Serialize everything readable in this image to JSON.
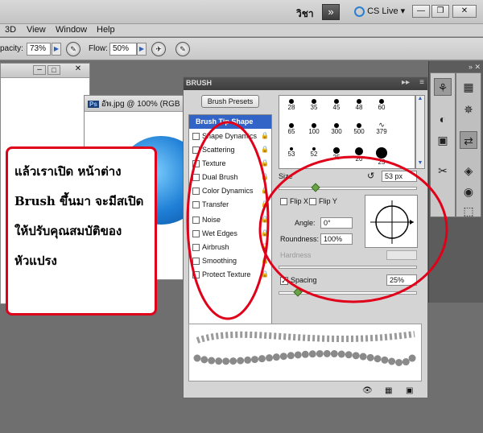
{
  "topbar": {
    "user_label": "วิชา",
    "cs_live": "CS Live",
    "minimize": "—",
    "restore": "❐",
    "close": "✕"
  },
  "menu": {
    "items": [
      "3D",
      "View",
      "Window",
      "Help"
    ]
  },
  "options_bar": {
    "opacity_label": "pacity:",
    "opacity_value": "73%",
    "flow_label": "Flow:",
    "flow_value": "50%"
  },
  "document": {
    "tab_title": "อัพ.jpg @ 100% (RGB",
    "ps_badge": "Ps"
  },
  "brush_panel": {
    "tab_title": "BRUSH",
    "presets_button": "Brush Presets",
    "options": [
      {
        "label": "Brush Tip Shape",
        "checkbox": false,
        "lock": false,
        "selected": true
      },
      {
        "label": "Shape Dynamics",
        "checkbox": true,
        "lock": true,
        "selected": false
      },
      {
        "label": "Scattering",
        "checkbox": true,
        "lock": true,
        "selected": false
      },
      {
        "label": "Texture",
        "checkbox": true,
        "lock": true,
        "selected": false
      },
      {
        "label": "Dual Brush",
        "checkbox": true,
        "lock": true,
        "selected": false
      },
      {
        "label": "Color Dynamics",
        "checkbox": true,
        "lock": true,
        "selected": false
      },
      {
        "label": "Transfer",
        "checkbox": true,
        "lock": true,
        "selected": false
      },
      {
        "label": "Noise",
        "checkbox": true,
        "lock": true,
        "selected": false
      },
      {
        "label": "Wet Edges",
        "checkbox": true,
        "lock": true,
        "selected": false
      },
      {
        "label": "Airbrush",
        "checkbox": true,
        "lock": true,
        "selected": false
      },
      {
        "label": "Smoothing",
        "checkbox": true,
        "lock": true,
        "selected": false
      },
      {
        "label": "Protect Texture",
        "checkbox": true,
        "lock": true,
        "selected": false
      }
    ],
    "tip_sizes": [
      [
        "28",
        "35",
        "45",
        "48",
        "60"
      ],
      [
        "65",
        "100",
        "300",
        "500",
        "379"
      ],
      [
        "53",
        "52",
        "25",
        "20",
        "25"
      ]
    ],
    "size_label": "Size",
    "size_value": "53 px",
    "flip_x": "Flip X",
    "flip_y": "Flip Y",
    "angle_label": "Angle:",
    "angle_value": "0°",
    "roundness_label": "Roundness:",
    "roundness_value": "100%",
    "hardness_label": "Hardness",
    "spacing_label": "Spacing",
    "spacing_value": "25%"
  },
  "annotation": {
    "lines": [
      "แล้วเราเปิด หน้าต่าง",
      "Brush ขึ้นมา จะมีสเปิด",
      "ให้ปรับคุณสมบัติของ",
      "หัวแปรง"
    ]
  },
  "colors": {
    "highlight": "#e0001a",
    "selected": "#3264c8"
  }
}
